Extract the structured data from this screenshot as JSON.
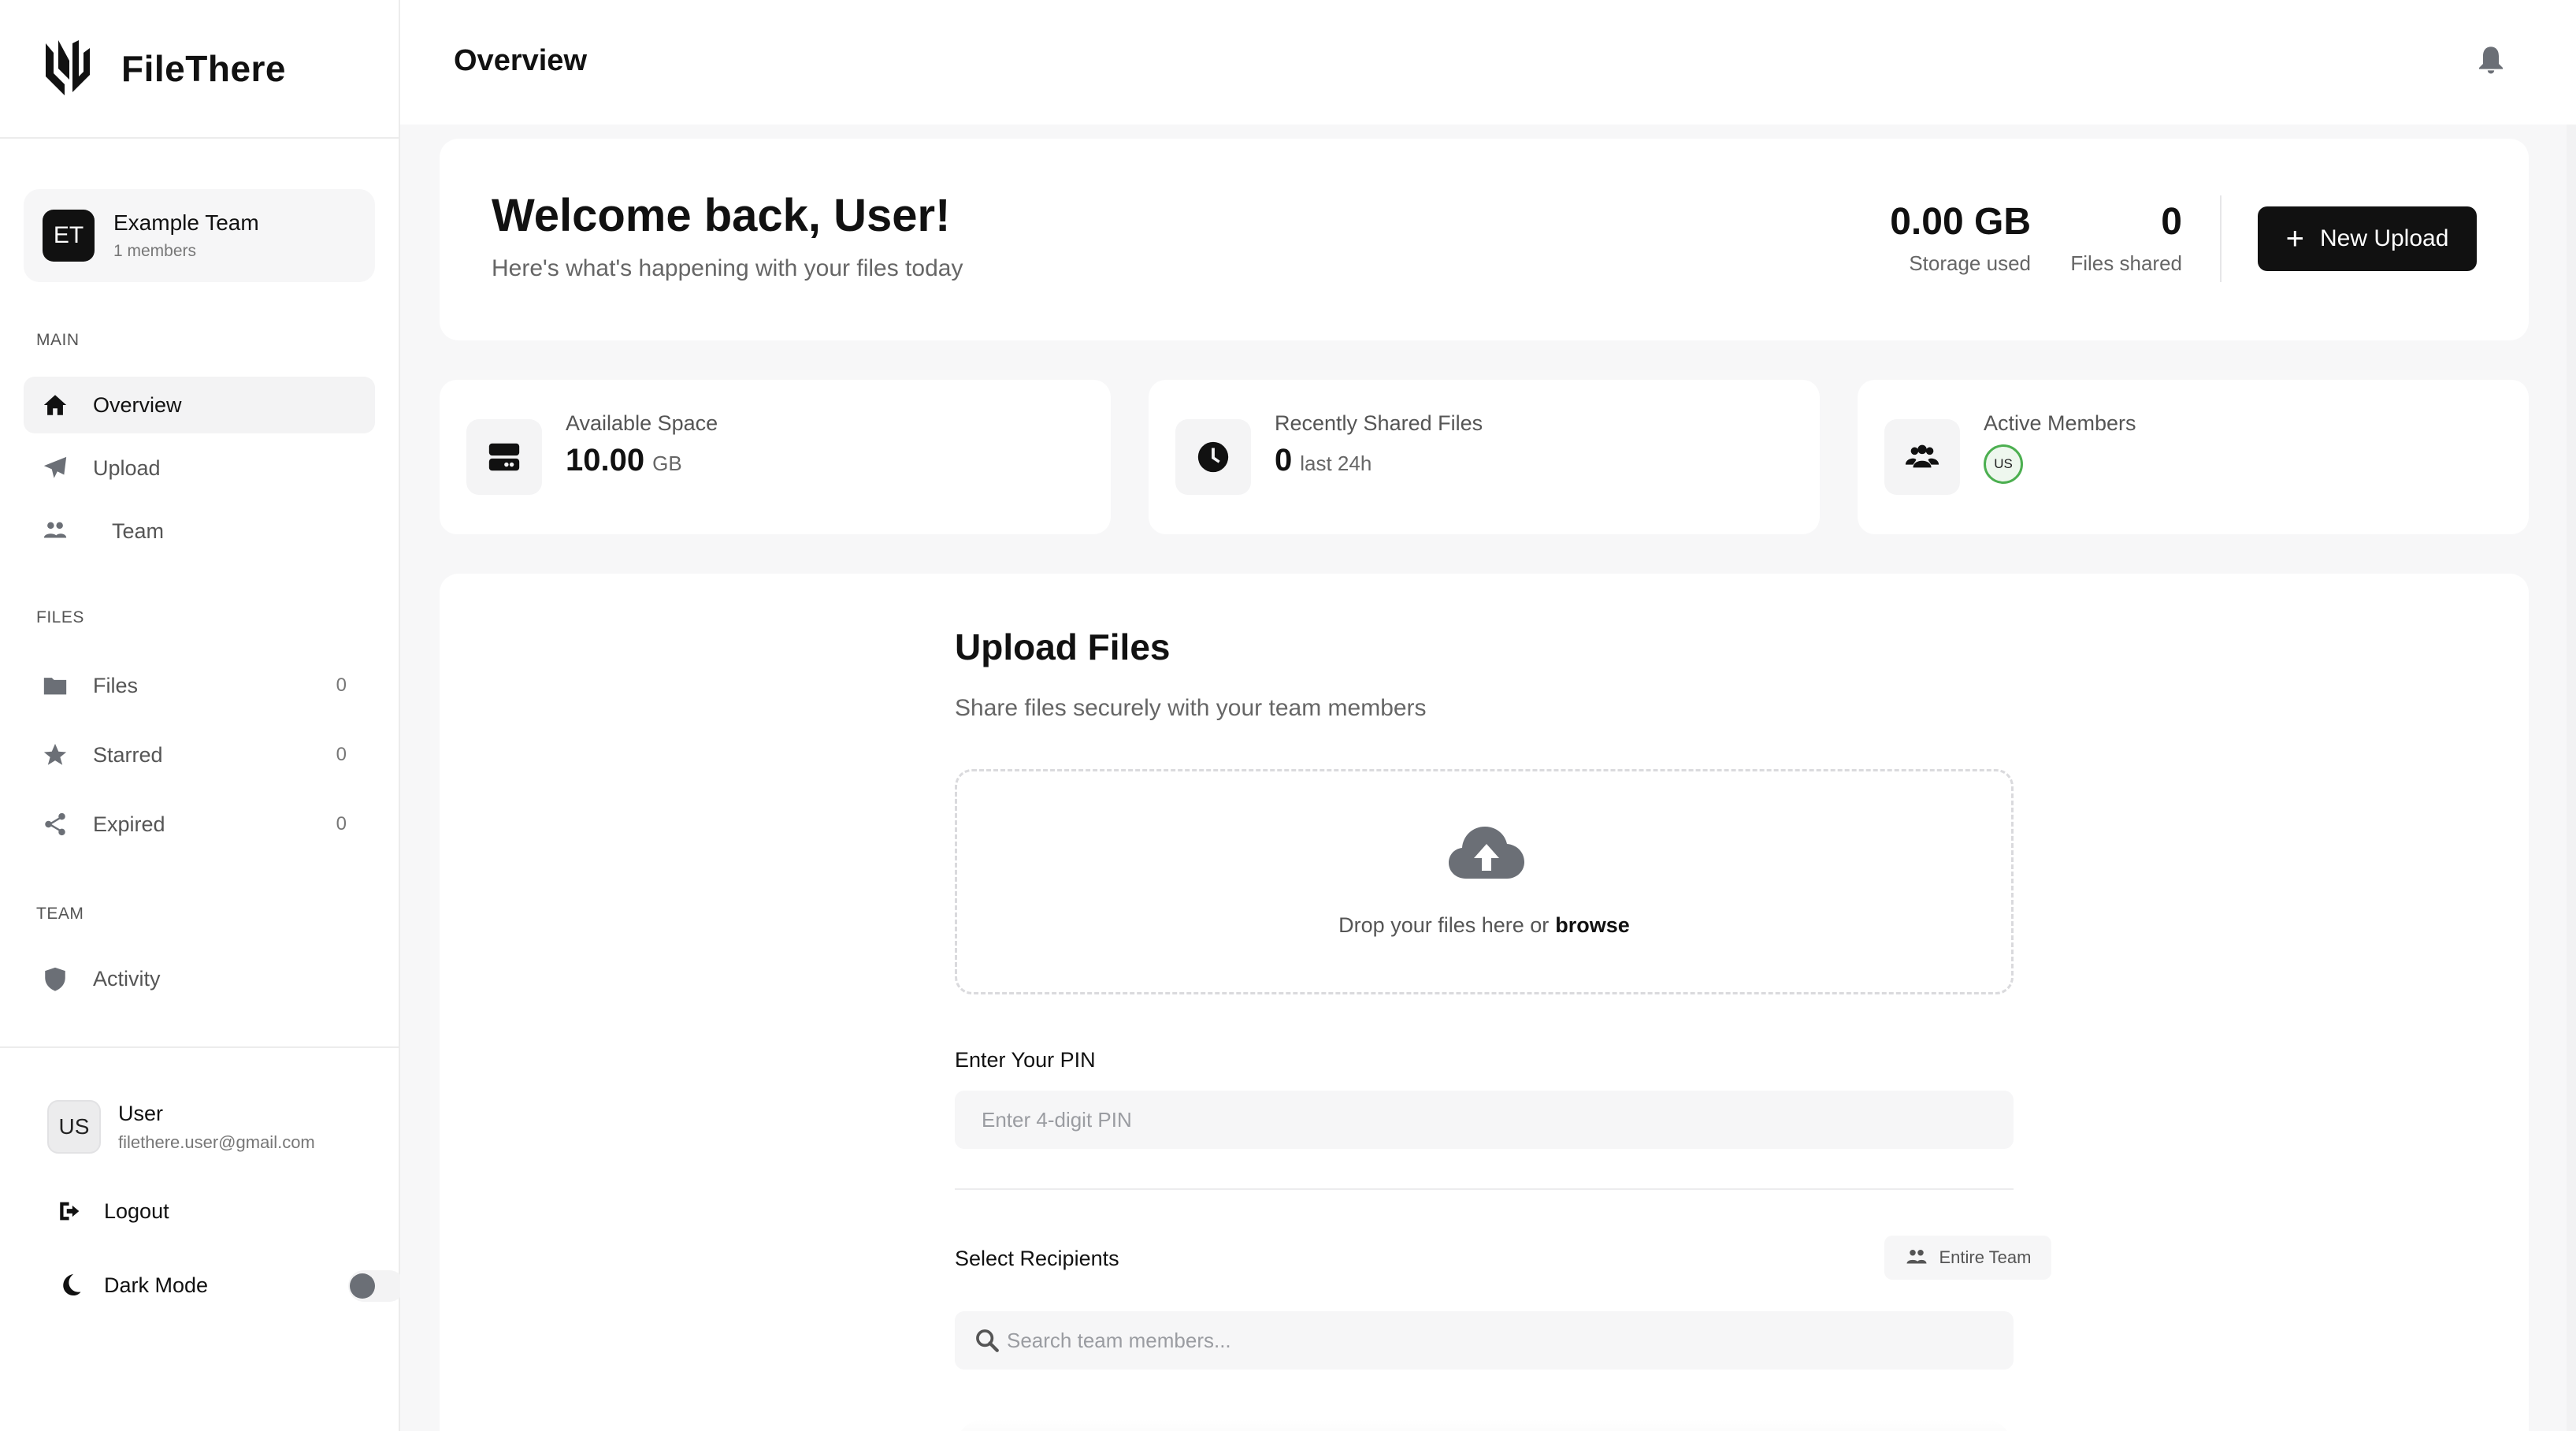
{
  "brand": {
    "name": "FileThere"
  },
  "team": {
    "initials": "ET",
    "name": "Example Team",
    "members": "1 members"
  },
  "sidebar": {
    "sections": {
      "main": "MAIN",
      "files": "FILES",
      "team": "TEAM"
    },
    "main_items": [
      {
        "label": "Overview",
        "icon": "home-icon",
        "active": true
      },
      {
        "label": "Upload",
        "icon": "paper-plane-icon"
      },
      {
        "label": "Team",
        "icon": "users-icon"
      }
    ],
    "file_items": [
      {
        "label": "Files",
        "icon": "folder-icon",
        "count": "0"
      },
      {
        "label": "Starred",
        "icon": "star-icon",
        "count": "0"
      },
      {
        "label": "Expired",
        "icon": "share-nodes-icon",
        "count": "0"
      }
    ],
    "team_items": [
      {
        "label": "Activity",
        "icon": "shield-icon"
      }
    ]
  },
  "user": {
    "initials": "US",
    "name": "User",
    "email": "filethere.user@gmail.com"
  },
  "actions": {
    "logout": "Logout",
    "dark_mode": "Dark Mode",
    "dark_mode_on": false
  },
  "header": {
    "title": "Overview"
  },
  "welcome": {
    "title": "Welcome back, User!",
    "subtitle": "Here's what's happening with your files today",
    "storage_value": "0.00 GB",
    "storage_label": "Storage used",
    "shared_value": "0",
    "shared_label": "Files shared",
    "new_upload": "New Upload"
  },
  "cards": {
    "space": {
      "title": "Available Space",
      "value": "10.00",
      "unit": "GB"
    },
    "recent": {
      "title": "Recently Shared Files",
      "value": "0",
      "unit": "last 24h"
    },
    "members": {
      "title": "Active Members",
      "member_initials": "US"
    }
  },
  "upload": {
    "title": "Upload Files",
    "subtitle": "Share files securely with your team members",
    "drop_text": "Drop your files here or",
    "browse": "browse",
    "pin_label": "Enter Your PIN",
    "pin_placeholder": "Enter 4-digit PIN",
    "recipients_label": "Select Recipients",
    "entire_team": "Entire Team",
    "search_placeholder": "Search team members..."
  },
  "colors": {
    "accent": "#111111",
    "muted": "#6b6f76",
    "member_ring": "#4caf50"
  }
}
